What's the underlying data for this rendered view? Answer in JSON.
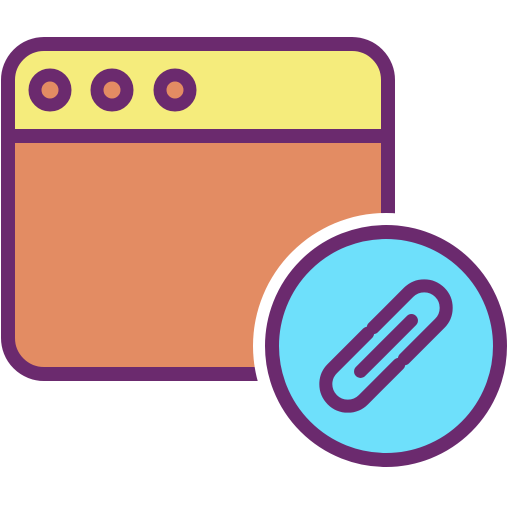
{
  "icon": {
    "name": "browser-link-icon",
    "colors": {
      "outline": "#6b2a6e",
      "titlebar": "#f5ec7c",
      "body": "#e38c63",
      "dot_fill": "#e38c63",
      "badge": "#6ee0fb"
    },
    "window_dots": 3
  }
}
